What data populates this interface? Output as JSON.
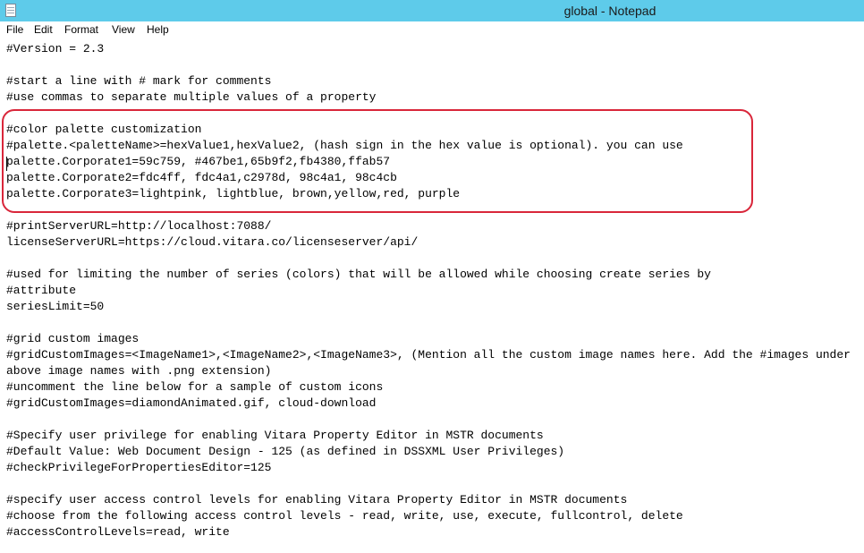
{
  "window": {
    "title": "global - Notepad"
  },
  "menubar": {
    "items": [
      "File",
      "Edit",
      "Format",
      "View",
      "Help"
    ]
  },
  "editor": {
    "lines": [
      "#Version = 2.3",
      "",
      "#start a line with # mark for comments",
      "#use commas to separate multiple values of a property",
      "",
      "#color palette customization",
      "#palette.<paletteName>=hexValue1,hexValue2, (hash sign in the hex value is optional). you can use",
      "palette.Corporate1=59c759, #467be1,65b9f2,fb4380,ffab57",
      "palette.Corporate2=fdc4ff, fdc4a1,c2978d, 98c4a1, 98c4cb",
      "palette.Corporate3=lightpink, lightblue, brown,yellow,red, purple",
      "",
      "#printServerURL=http://localhost:7088/",
      "licenseServerURL=https://cloud.vitara.co/licenseserver/api/",
      "",
      "#used for limiting the number of series (colors) that will be allowed while choosing create series by",
      "#attribute",
      "seriesLimit=50",
      "",
      "#grid custom images",
      "#gridCustomImages=<ImageName1>,<ImageName2>,<ImageName3>, (Mention all the custom image names here. Add the #images under",
      "above image names with .png extension)",
      "#uncomment the line below for a sample of custom icons",
      "#gridCustomImages=diamondAnimated.gif, cloud-download",
      "",
      "#Specify user privilege for enabling Vitara Property Editor in MSTR documents",
      "#Default Value: Web Document Design - 125 (as defined in DSSXML User Privileges)",
      "#checkPrivilegeForPropertiesEditor=125",
      "",
      "#specify user access control levels for enabling Vitara Property Editor in MSTR documents",
      "#choose from the following access control levels - read, write, use, execute, fullcontrol, delete",
      "#accessControlLevels=read, write"
    ]
  },
  "colors": {
    "titlebar": "#5ecbea",
    "highlight_border": "#d9263a"
  }
}
